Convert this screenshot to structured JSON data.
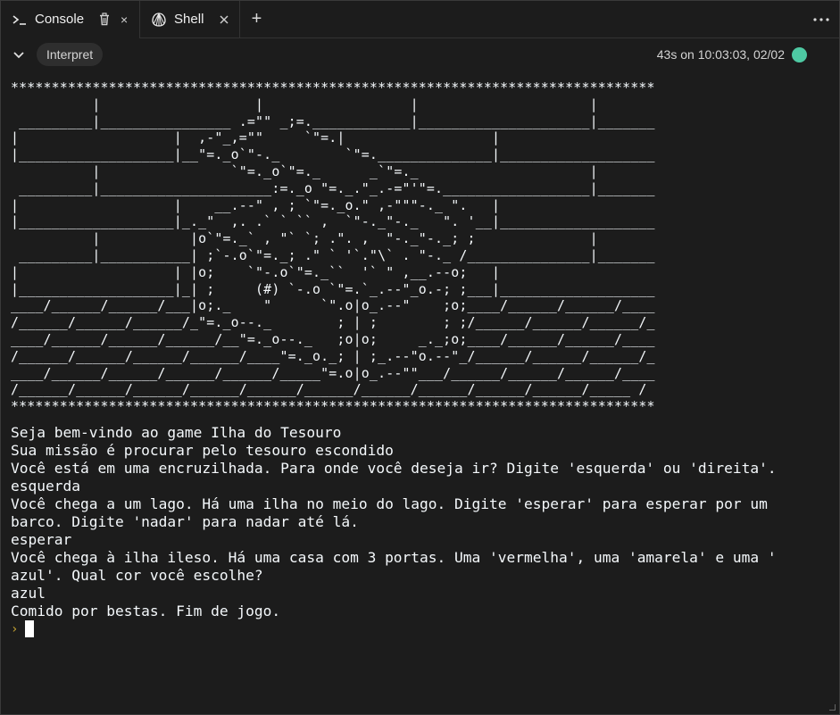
{
  "tabs": [
    {
      "label": "Console",
      "icon": "terminal-icon",
      "action_icon": "trash-icon"
    },
    {
      "label": "Shell",
      "icon": "shell-icon",
      "action_icon": "close-icon"
    }
  ],
  "console_tab_close": "×",
  "add_tab": "+",
  "toolbar": {
    "interpret_label": "Interpret",
    "run_status": "43s on 10:03:03, 02/02",
    "status_color": "#4ec9a3"
  },
  "console": {
    "ascii_art": "*******************************************************************************\n          |                   |                  |                     |\n _________|________________ .=\"\" _;=.____________|_____________________|_______\n|                   |  ,-\"_,=\"\"     `\"=.|                  |\n|___________________|__\"=._o`\"-._        `\"=.______________|___________________\n          |                `\"=._o`\"=._      _`\"=._                     |\n _________|_____________________:=._o \"=._.\"_.-=\"'\"=.__________________|_______\n|                   |    __.--\" , ; `\"=._o.\" ,-\"\"\"-._ \".   |\n|___________________|_._\"  ,. .` ` `` ,  `\"-._\"-._   \". '__|___________________\n          |           |o`\"=._` , \"` `; .\". ,  \"-._\"-._; ;              |\n _________|___________| ;`-.o`\"=._; .\" ` '`.\"\\` . \"-._ /_______________|_______\n|                   | |o;    `\"-.o`\"=._``  '` \" ,__.--o;   |\n|___________________|_| ;     (#) `-.o `\"=.`_.--\"_o.-; ;___|___________________\n____/______/______/___|o;._    \"      `\".o|o_.--\"    ;o;____/______/______/____\n/______/______/______/_\"=._o--._        ; | ;        ; ;/______/______/______/_\n____/______/______/______/__\"=._o--._   ;o|o;     _._;o;____/______/______/____\n/______/______/______/______/____\"=._o._; | ;_.--\"o.--\"_/______/______/______/_\n____/______/______/______/______/_____\"=.o|o_.--\"\"___/______/______/______/____\n/______/______/______/______/______/______/______/______/______/______/_____ /\n*******************************************************************************",
    "lines": [
      "Seja bem-vindo ao game Ilha do Tesouro",
      "Sua missão é procurar pelo tesouro escondido",
      "Você está em uma encruzilhada. Para onde você deseja ir? Digite 'esquerda' ou 'direita'.",
      "esquerda",
      "Você chega a um lago. Há uma ilha no meio do lago. Digite 'esperar' para esperar por um",
      "barco. Digite 'nadar' para nadar até lá.",
      "esperar",
      "Você chega à ilha ileso. Há uma casa com 3 portas. Uma 'vermelha', uma 'amarela' e uma '",
      "azul'. Qual cor você escolhe?",
      "azul",
      "Comido por bestas. Fim de jogo."
    ],
    "prompt_symbol": "›",
    "input_value": ""
  }
}
